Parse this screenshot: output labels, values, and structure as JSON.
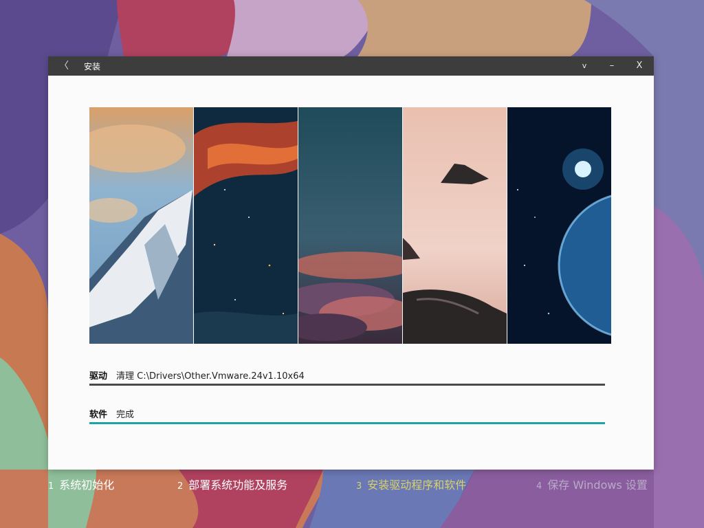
{
  "window": {
    "title": "安装",
    "back_glyph": "〈",
    "menu_glyph": "v",
    "minimize_glyph": "–",
    "close_glyph": "X"
  },
  "progress": [
    {
      "label": "驱动",
      "status": "清理 C:\\Drivers\\Other.Vmware.24v1.10x64",
      "fraction": 1.0,
      "color": "#4a4a4a"
    },
    {
      "label": "软件",
      "status": "完成",
      "fraction": 1.0,
      "color": "#1aa3a8"
    }
  ],
  "steps": [
    {
      "num": "1",
      "label": "系统初始化",
      "state": "done"
    },
    {
      "num": "2",
      "label": "部署系统功能及服务",
      "state": "done"
    },
    {
      "num": "3",
      "label": "安装驱动程序和软件",
      "state": "current"
    },
    {
      "num": "4",
      "label": "保存 Windows 设置",
      "state": "pending"
    }
  ],
  "colors": {
    "step_done": "#ffffff",
    "step_current": "#d7d26a",
    "step_pending": "#b9aac9",
    "titlebar": "#3d3d3d"
  },
  "icons": {
    "back": "chevron-left-icon",
    "menu": "chevron-down-icon",
    "minimize": "minimize-icon",
    "close": "close-icon"
  }
}
